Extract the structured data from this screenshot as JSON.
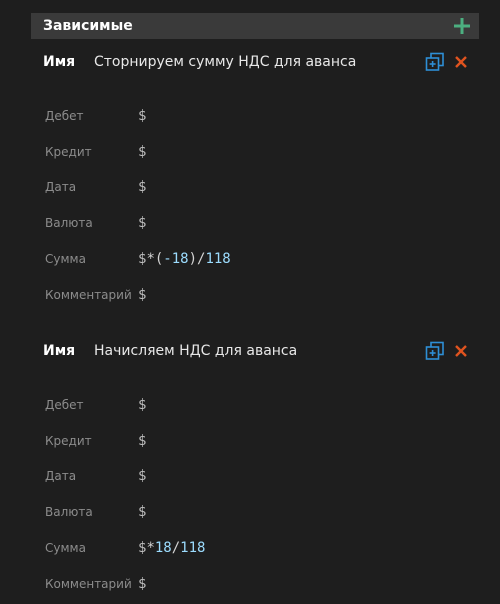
{
  "section": {
    "title": "Зависимые"
  },
  "entries": [
    {
      "name_label": "Имя",
      "name_value": "Сторнируем сумму НДС для аванса",
      "fields": [
        {
          "label": "Дебет",
          "tokens": [
            "$"
          ]
        },
        {
          "label": "Кредит",
          "tokens": [
            "$"
          ]
        },
        {
          "label": "Дата",
          "tokens": [
            "$"
          ]
        },
        {
          "label": "Валюта",
          "tokens": [
            "$"
          ]
        },
        {
          "label": "Сумма",
          "tokens": [
            "$",
            "*(",
            "-18",
            ")/",
            "118"
          ]
        },
        {
          "label": "Комментарий",
          "tokens": [
            "$"
          ]
        }
      ]
    },
    {
      "name_label": "Имя",
      "name_value": "Начисляем НДС для аванса",
      "fields": [
        {
          "label": "Дебет",
          "tokens": [
            "$"
          ]
        },
        {
          "label": "Кредит",
          "tokens": [
            "$"
          ]
        },
        {
          "label": "Дата",
          "tokens": [
            "$"
          ]
        },
        {
          "label": "Валюта",
          "tokens": [
            "$"
          ]
        },
        {
          "label": "Сумма",
          "tokens": [
            "$",
            "*",
            "18",
            "/",
            "118"
          ]
        },
        {
          "label": "Комментарий",
          "tokens": [
            "$"
          ]
        }
      ]
    }
  ],
  "colors": {
    "add_icon": "#4caf80",
    "duplicate_icon": "#2e8fd6",
    "delete_icon": "#e0531f",
    "number": "#9cdcfe"
  }
}
